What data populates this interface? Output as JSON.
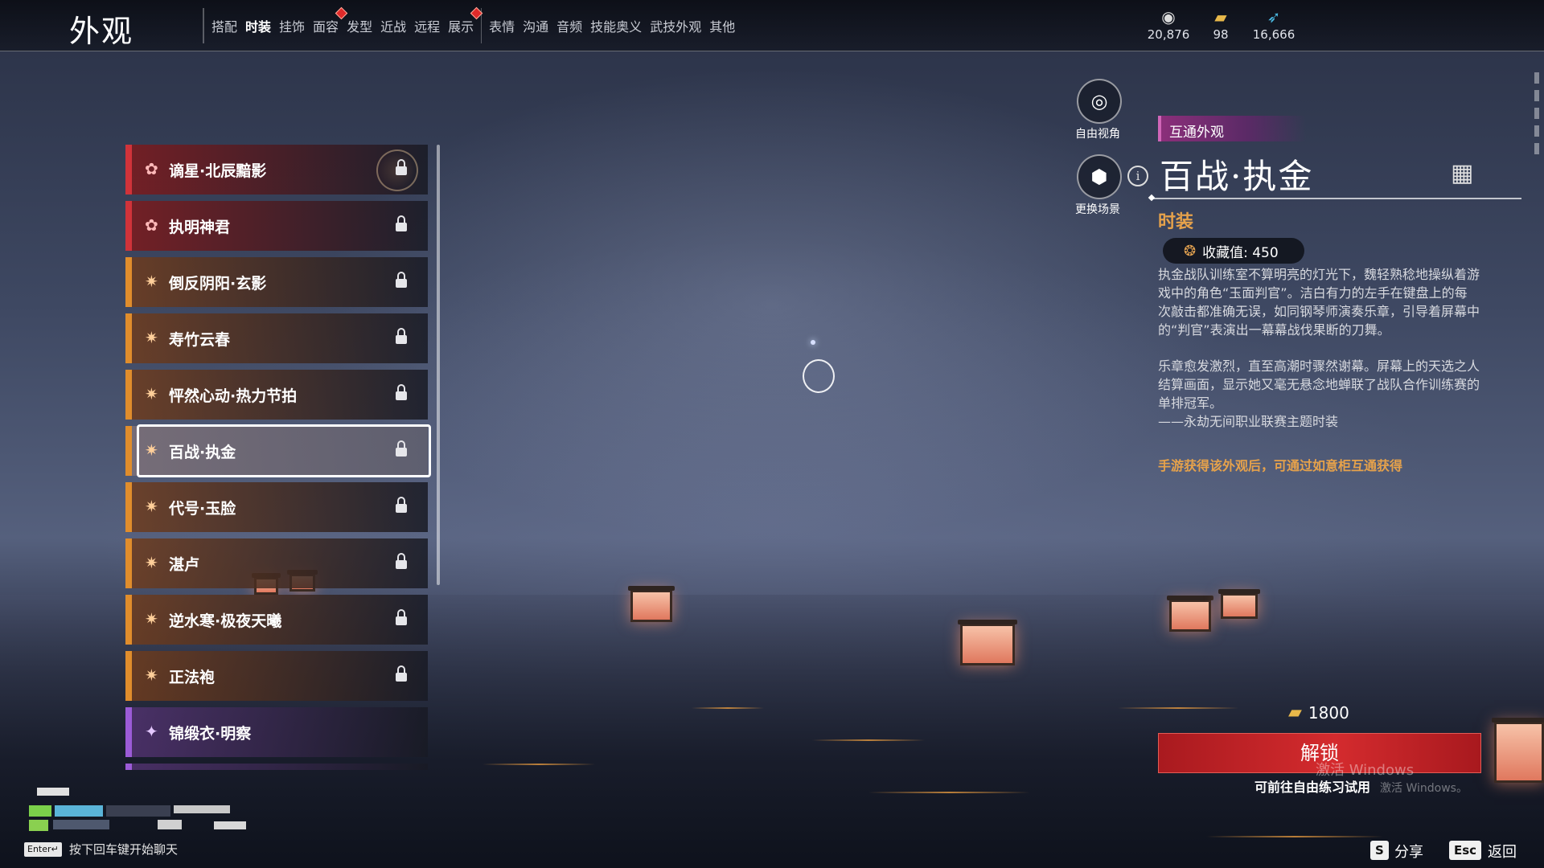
{
  "header": {
    "title": "外观",
    "tabs": [
      {
        "label": "搭配",
        "active": false,
        "badge": false
      },
      {
        "label": "时装",
        "active": true,
        "badge": false
      },
      {
        "label": "挂饰",
        "active": false,
        "badge": false
      },
      {
        "label": "面容",
        "active": false,
        "badge": true
      },
      {
        "label": "发型",
        "active": false,
        "badge": false
      },
      {
        "label": "近战",
        "active": false,
        "badge": false
      },
      {
        "label": "远程",
        "active": false,
        "badge": false
      },
      {
        "label": "展示",
        "active": false,
        "badge": true
      },
      {
        "label": "表情",
        "active": false,
        "badge": false
      },
      {
        "label": "沟通",
        "active": false,
        "badge": false
      },
      {
        "label": "音频",
        "active": false,
        "badge": false
      },
      {
        "label": "技能奥义",
        "active": false,
        "badge": false
      },
      {
        "label": "武技外观",
        "active": false,
        "badge": false
      },
      {
        "label": "其他",
        "active": false,
        "badge": false
      }
    ],
    "currencies": [
      {
        "icon": "coin-stack-icon",
        "value": "20,876"
      },
      {
        "icon": "gold-ingot-icon",
        "value": "98"
      },
      {
        "icon": "feather-icon",
        "value": "16,666"
      }
    ]
  },
  "outfits": [
    {
      "name": "谪星·北辰黯影",
      "rarity": "red",
      "locked": true,
      "selected": false
    },
    {
      "name": "执明神君",
      "rarity": "red",
      "locked": true,
      "selected": false
    },
    {
      "name": "倒反阴阳·玄影",
      "rarity": "orange",
      "locked": true,
      "selected": false
    },
    {
      "name": "寿竹云春",
      "rarity": "orange",
      "locked": true,
      "selected": false
    },
    {
      "name": "怦然心动·热力节拍",
      "rarity": "orange",
      "locked": true,
      "selected": false
    },
    {
      "name": "百战·执金",
      "rarity": "orange",
      "locked": true,
      "selected": true
    },
    {
      "name": "代号·玉脸",
      "rarity": "orange",
      "locked": true,
      "selected": false
    },
    {
      "name": "湛卢",
      "rarity": "orange",
      "locked": true,
      "selected": false
    },
    {
      "name": "逆水寒·极夜天曦",
      "rarity": "orange",
      "locked": true,
      "selected": false
    },
    {
      "name": "正法袍",
      "rarity": "orange",
      "locked": true,
      "selected": false
    },
    {
      "name": "锦缎衣·明察",
      "rarity": "purple",
      "locked": false,
      "selected": false
    }
  ],
  "controls": {
    "free_view": "自由视角",
    "change_scene": "更换场景"
  },
  "detail": {
    "tag": "互通外观",
    "title": "百战·执金",
    "category": "时装",
    "collection_label": "收藏值: 450",
    "description": [
      "执金战队训练室不算明亮的灯光下，魏轻熟稔地操纵着游戏中的角色“玉面判官”。洁白有力的左手在键盘上的每次敲击都准确无误，如同钢琴师演奏乐章，引导着屏幕中的“判官”表演出一幕幕战伐果断的刀舞。",
      "乐章愈发激烈，直至高潮时骤然谢幕。屏幕上的天选之人结算画面，显示她又毫无悬念地蝉联了战队合作训练赛的单排冠军。",
      "——永劫无间职业联赛主题时装"
    ],
    "note": "手游获得该外观后，可通过如意柜互通获得",
    "price": "1800",
    "unlock_label": "解锁",
    "trial_text": "可前往自由练习试用",
    "watermark": "激活 Windows",
    "watermark_small": "激活 Windows。"
  },
  "footer": {
    "enter_key": "Enter↵",
    "chat_hint": "按下回车键开始聊天",
    "share_key": "S",
    "share_label": "分享",
    "back_key": "Esc",
    "back_label": "返回"
  },
  "colors": {
    "accent_red": "#c8242a",
    "rarity_red": "#d0333a",
    "rarity_orange": "#e08d2c",
    "rarity_purple": "#9b5bd6",
    "gold_text": "#e6a24b"
  }
}
